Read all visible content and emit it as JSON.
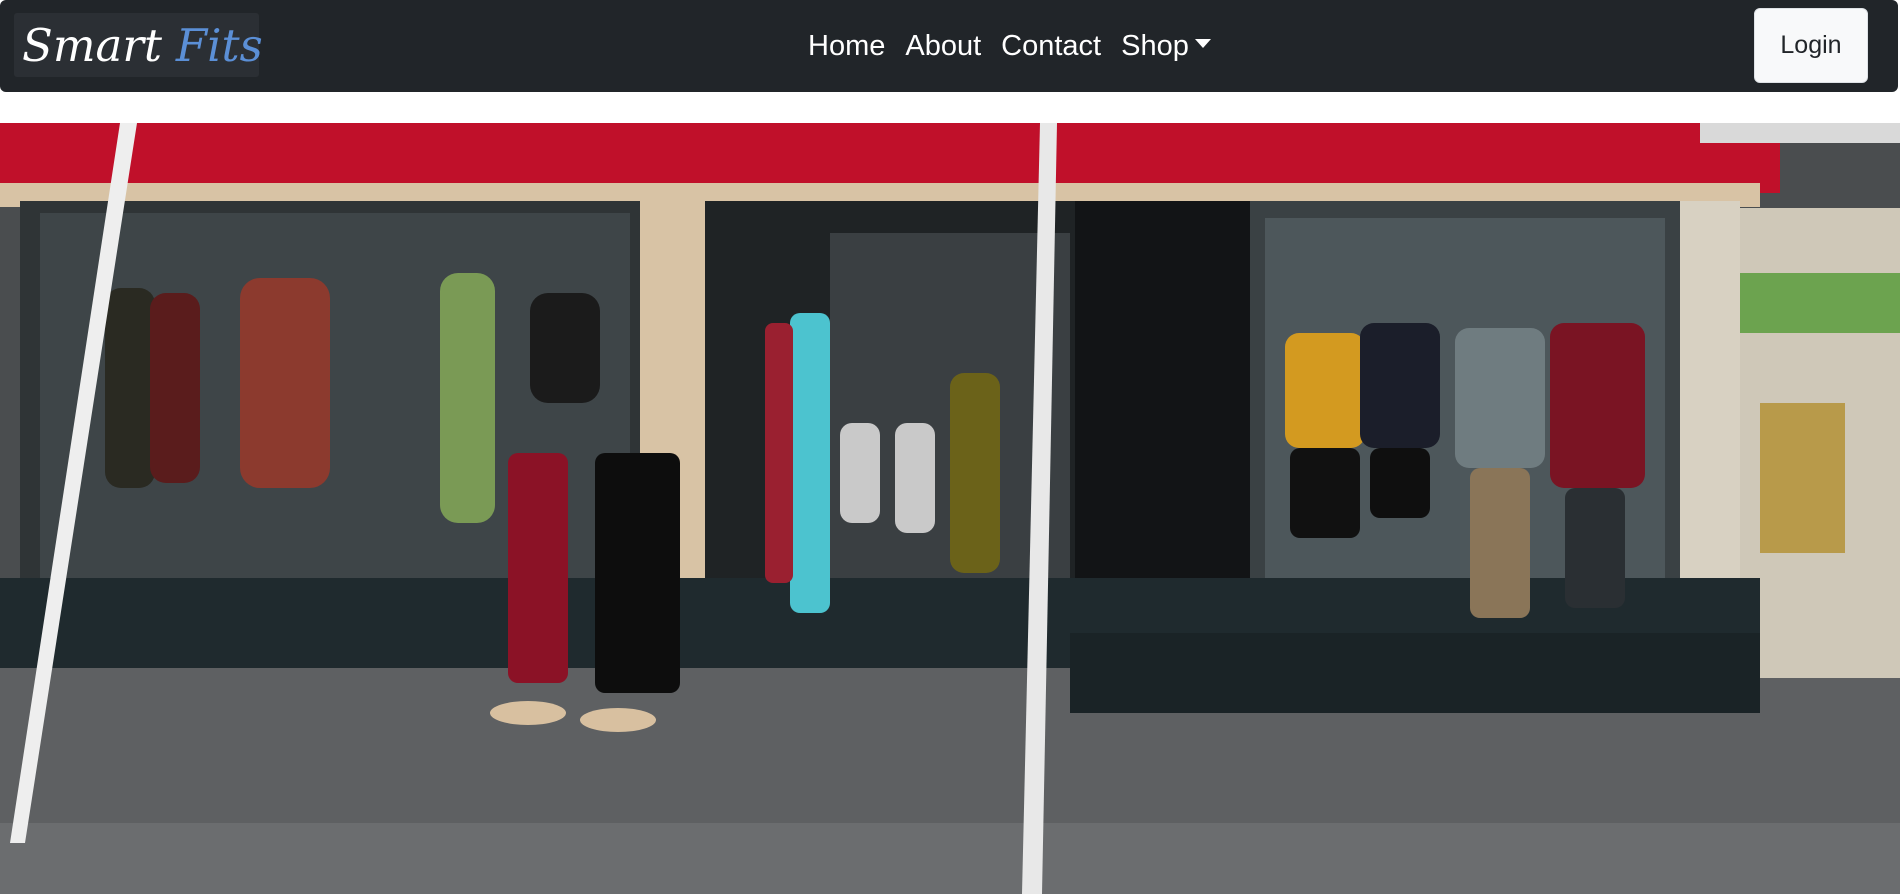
{
  "brand": {
    "part1": "Smart",
    "part2": "Fits"
  },
  "nav": {
    "home": "Home",
    "about": "About",
    "contact": "Contact",
    "shop": "Shop"
  },
  "login_label": "Login",
  "colors": {
    "navbar_bg": "#212529",
    "brand_accent": "#5b8fd6",
    "login_bg": "#f8f9fa",
    "awning_red": "#c0102a"
  }
}
